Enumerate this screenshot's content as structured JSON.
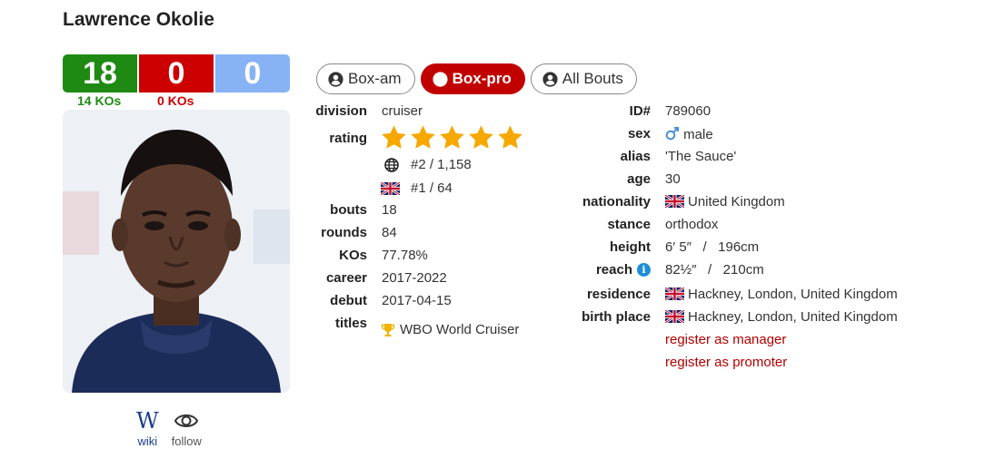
{
  "boxer": {
    "name": "Lawrence Okolie"
  },
  "record": {
    "wins": "18",
    "losses": "0",
    "draws": "0",
    "wins_kos": "14 KOs",
    "losses_kos": "0 KOs"
  },
  "links": {
    "wiki": "wiki",
    "follow": "follow"
  },
  "tabs": [
    {
      "label": "Box-am",
      "active": false
    },
    {
      "label": "Box-pro",
      "active": true
    },
    {
      "label": "All Bouts",
      "active": false
    }
  ],
  "left_info": {
    "division": {
      "label": "division",
      "value": "cruiser"
    },
    "rating": {
      "label": "rating",
      "stars": 5,
      "world_rank": "#2 / 1,158",
      "country_rank": "#1 / 64"
    },
    "bouts": {
      "label": "bouts",
      "value": "18"
    },
    "rounds": {
      "label": "rounds",
      "value": "84"
    },
    "kos": {
      "label": "KOs",
      "value": "77.78%"
    },
    "career": {
      "label": "career",
      "value": "2017-2022"
    },
    "debut": {
      "label": "debut",
      "value": "2017-04-15"
    },
    "titles": {
      "label": "titles",
      "value": "WBO World Cruiser"
    }
  },
  "right_info": {
    "id": {
      "label": "ID#",
      "value": "789060"
    },
    "sex": {
      "label": "sex",
      "value": "male"
    },
    "alias": {
      "label": "alias",
      "value": "'The Sauce'"
    },
    "age": {
      "label": "age",
      "value": "30"
    },
    "nationality": {
      "label": "nationality",
      "value": "United Kingdom"
    },
    "stance": {
      "label": "stance",
      "value": "orthodox"
    },
    "height": {
      "label": "height",
      "value": "6′ 5″   /   196cm"
    },
    "reach": {
      "label": "reach",
      "value": "82½″   /   210cm",
      "info": "i"
    },
    "residence": {
      "label": "residence",
      "value": "Hackney, London, United Kingdom"
    },
    "birth_place": {
      "label": "birth place",
      "value": "Hackney, London, United Kingdom"
    },
    "register_manager": "register as manager",
    "register_promoter": "register as promoter"
  },
  "colors": {
    "win": "#1f8a13",
    "loss": "#cc0000",
    "draw": "#87b3f5",
    "accent": "#c10000",
    "star": "#f6a800"
  }
}
